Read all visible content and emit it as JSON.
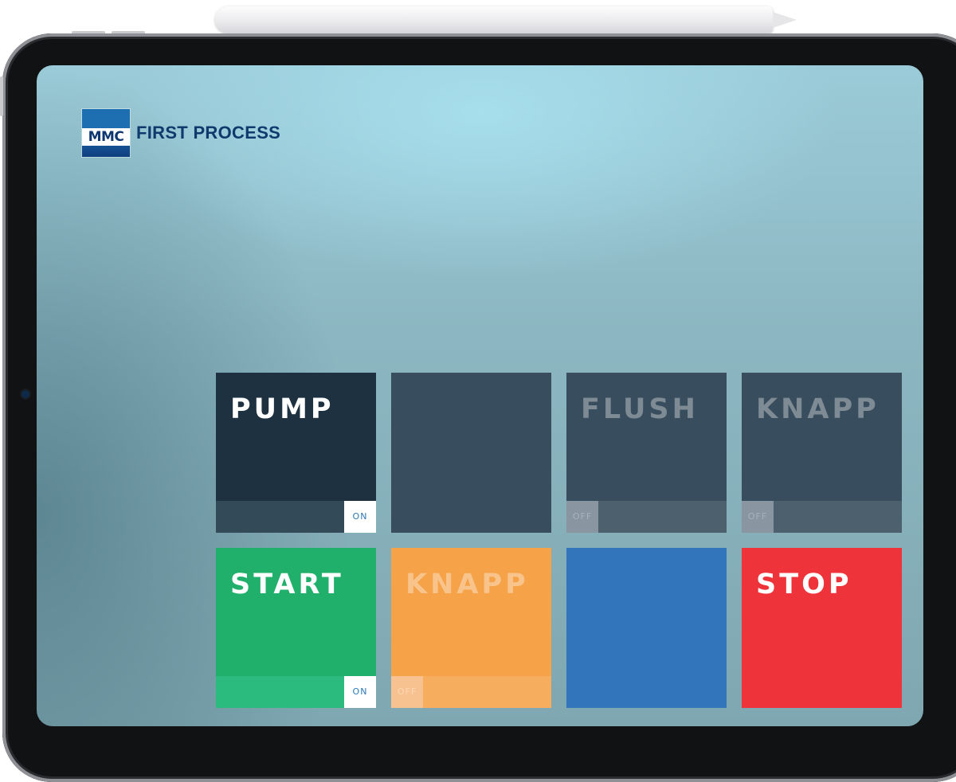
{
  "brand": {
    "logo_mark": "MMC",
    "name": "FIRST PROCESS"
  },
  "tiles": [
    {
      "label": "PUMP",
      "toggle": "ON",
      "color": "#1d3140"
    },
    {
      "label": "",
      "color": "#384d5d"
    },
    {
      "label": "FLUSH",
      "toggle": "OFF",
      "color": "#384d5d"
    },
    {
      "label": "KNAPP",
      "toggle": "OFF",
      "color": "#384d5d"
    },
    {
      "label": "START",
      "toggle": "ON",
      "color": "#21b06b"
    },
    {
      "label": "KNAPP",
      "toggle": "OFF",
      "color": "#f5a248"
    },
    {
      "label": "",
      "color": "#3275bb"
    },
    {
      "label": "STOP",
      "color": "#ee333a"
    }
  ]
}
